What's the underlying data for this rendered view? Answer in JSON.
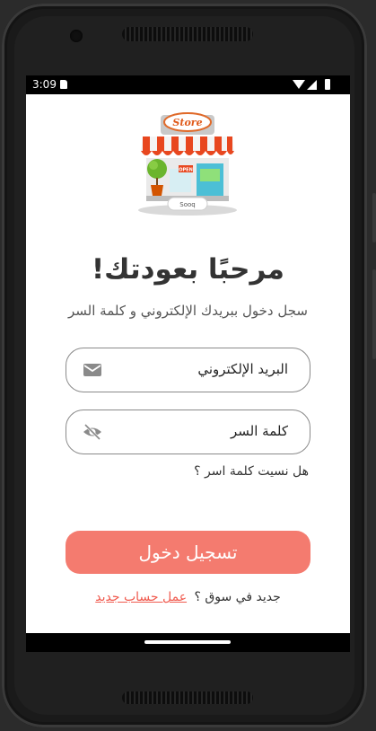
{
  "status_bar": {
    "time": "3:09",
    "icons": [
      "sd-card-icon",
      "wifi-icon",
      "signal-icon",
      "battery-icon"
    ]
  },
  "logo": {
    "sign_text": "Store",
    "open_sign": "OPEN",
    "tag_text": "Sooq"
  },
  "header": {
    "title": "مرحبًا بعودتك!",
    "subtitle": "سجل دخول ببريدك الإلكتروني و كلمة السر"
  },
  "form": {
    "email_label": "البريد الإلكتروني",
    "email_icon": "mail-icon",
    "password_label": "كلمة السر",
    "password_icon": "eye-off-icon",
    "forgot_password": "هل نسيت كلمة اسر ؟"
  },
  "actions": {
    "login_label": "تسجيل دخول",
    "signup_prompt": "جديد في سوق ؟",
    "signup_link": "عمل حساب جديد"
  },
  "colors": {
    "accent": "#f47b6f",
    "link": "#f05a4e"
  }
}
